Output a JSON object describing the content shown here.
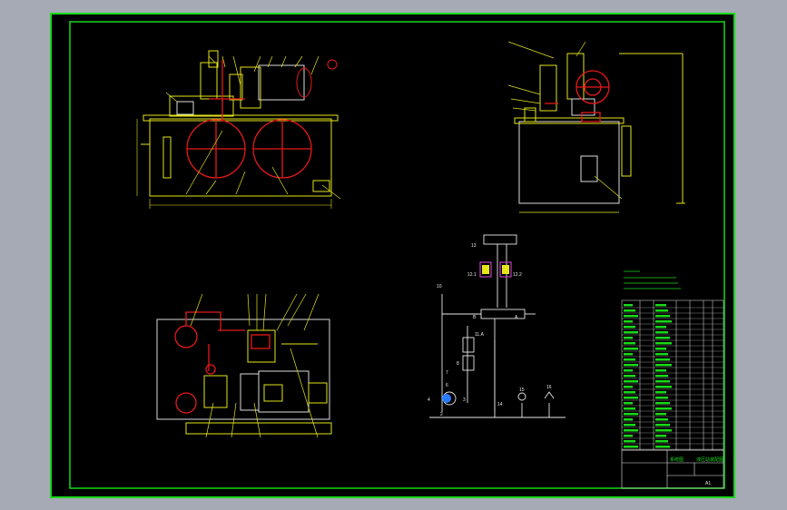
{
  "colors": {
    "background": "#a5aab4",
    "sheet": "#000000",
    "frame_green": "#18d818",
    "part_yellow": "#e5e51a",
    "section_red": "#e61919",
    "white": "#e8e8e8",
    "purple": "#c040c0"
  },
  "schematic": {
    "labels": {
      "top_cyl": "13",
      "valve_left": "12.1",
      "valve_right": "12.2",
      "gauge_left": "10",
      "dir_valve_a": "A",
      "dir_valve_b": "B",
      "relief": "11.A",
      "check": "8",
      "filter_mid": "7",
      "pump_a": "6",
      "pump_b": "5",
      "motor": "4",
      "pump_c": "3",
      "tank": "2",
      "line_14": "14",
      "line_15": "15",
      "line_16": "16"
    }
  },
  "title_block": {
    "name_left": "系统图",
    "name_right": "液压站装配图",
    "scale": "A1"
  }
}
